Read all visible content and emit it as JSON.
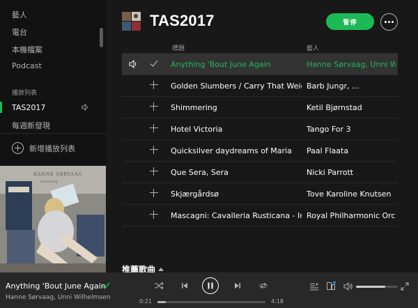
{
  "sidebar": {
    "nav": [
      {
        "label": "藝人"
      },
      {
        "label": "電台"
      },
      {
        "label": "本機檔案"
      },
      {
        "label": "Podcast"
      }
    ],
    "playlists_title": "播放列表",
    "playlists": [
      {
        "label": "TAS2017",
        "active": true
      },
      {
        "label": "每週新發現",
        "active": false
      }
    ],
    "new_playlist_label": "新增播放列表"
  },
  "playlist": {
    "title": "TAS2017",
    "pause_label": "暫停",
    "col_title": "標題",
    "col_artist": "藝人",
    "tracks": [
      {
        "title": "Anything 'Bout June Again",
        "artist": "Hanne Sørvaag, Unni Wilhelmsen",
        "playing": true
      },
      {
        "title": "Golden Slumbers / Carry That Weight",
        "artist": "Barb Jungr, ...",
        "playing": false
      },
      {
        "title": "Shimmering",
        "artist": "Ketil Bjørnstad",
        "playing": false
      },
      {
        "title": "Hotel Victoria",
        "artist": "Tango For 3",
        "playing": false
      },
      {
        "title": "Quicksilver daydreams of Maria",
        "artist": "Paal Flaata",
        "playing": false
      },
      {
        "title": "Que Sera, Sera",
        "artist": "Nicki Parrott",
        "playing": false
      },
      {
        "title": "Skjærgårdsø",
        "artist": "Tove Karoline Knutsen",
        "playing": false
      },
      {
        "title": "Mascagni: Cavalleria Rusticana - Intermezzo",
        "artist": "Royal Philharmonic Orchestra",
        "playing": false
      }
    ],
    "recommended_title": "推薦歌曲"
  },
  "player": {
    "track_title": "Anything 'Bout June Again",
    "track_artist": "Hanne Sørvaag, Unni Wilhelmsen",
    "elapsed": "0:21",
    "total": "4:18",
    "progress": 0.08,
    "volume": 0.7
  },
  "colors": {
    "accent": "#1db954",
    "sidebar_bg": "#121212",
    "main_bg": "#181818",
    "player_bg": "#282828"
  },
  "icons": [
    "speaker-icon",
    "check-icon",
    "plus-icon",
    "shuffle-icon",
    "skip-back-icon",
    "pause-icon",
    "skip-forward-icon",
    "repeat-icon",
    "queue-icon",
    "devices-icon",
    "volume-icon",
    "fullscreen-icon",
    "more-icon"
  ]
}
